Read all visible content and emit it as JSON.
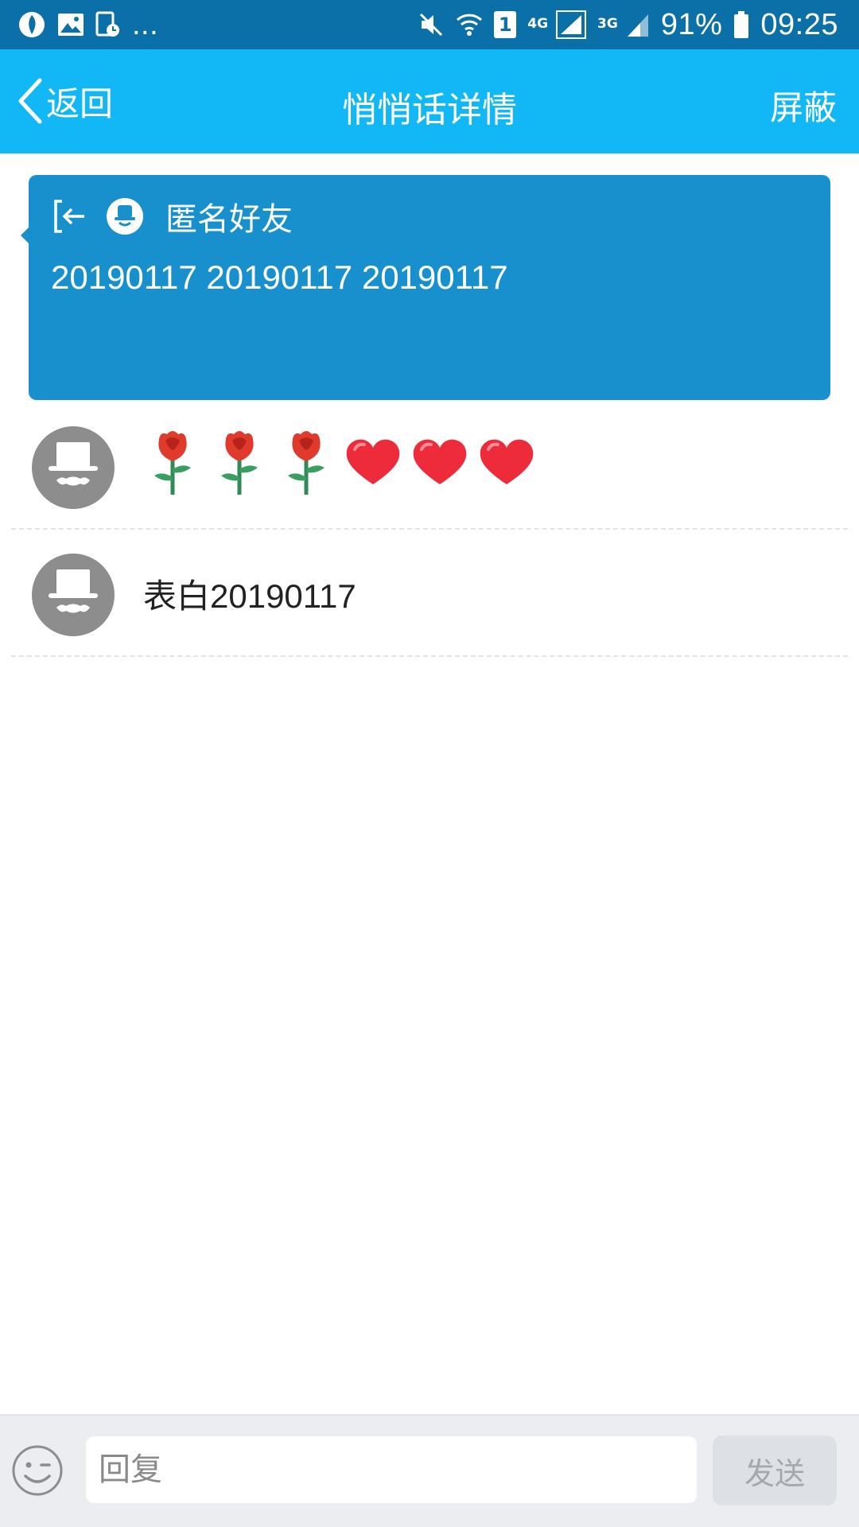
{
  "status_bar": {
    "notification_more": "...",
    "sim_badge": "1",
    "network_4g": "4G",
    "network_3g": "3G",
    "battery": "91%",
    "time": "09:25",
    "icons": [
      "app-notification-icon",
      "image-icon",
      "screenshot-icon",
      "mute-icon",
      "wifi-icon",
      "sim-icon",
      "signal-icon",
      "battery-icon"
    ]
  },
  "nav": {
    "back_label": "返回",
    "title": "悄悄话详情",
    "action_label": "屏蔽",
    "color": "#12b7f5"
  },
  "message": {
    "sender": "匿名好友",
    "text": "20190117 20190117 20190117",
    "color": "#1890cd"
  },
  "replies": [
    {
      "type": "emoji",
      "emoji": [
        "rose",
        "rose",
        "rose",
        "heart",
        "heart",
        "heart"
      ]
    },
    {
      "type": "text",
      "text": "表白20190117"
    }
  ],
  "composer": {
    "placeholder": "回复",
    "send_label": "发送"
  }
}
